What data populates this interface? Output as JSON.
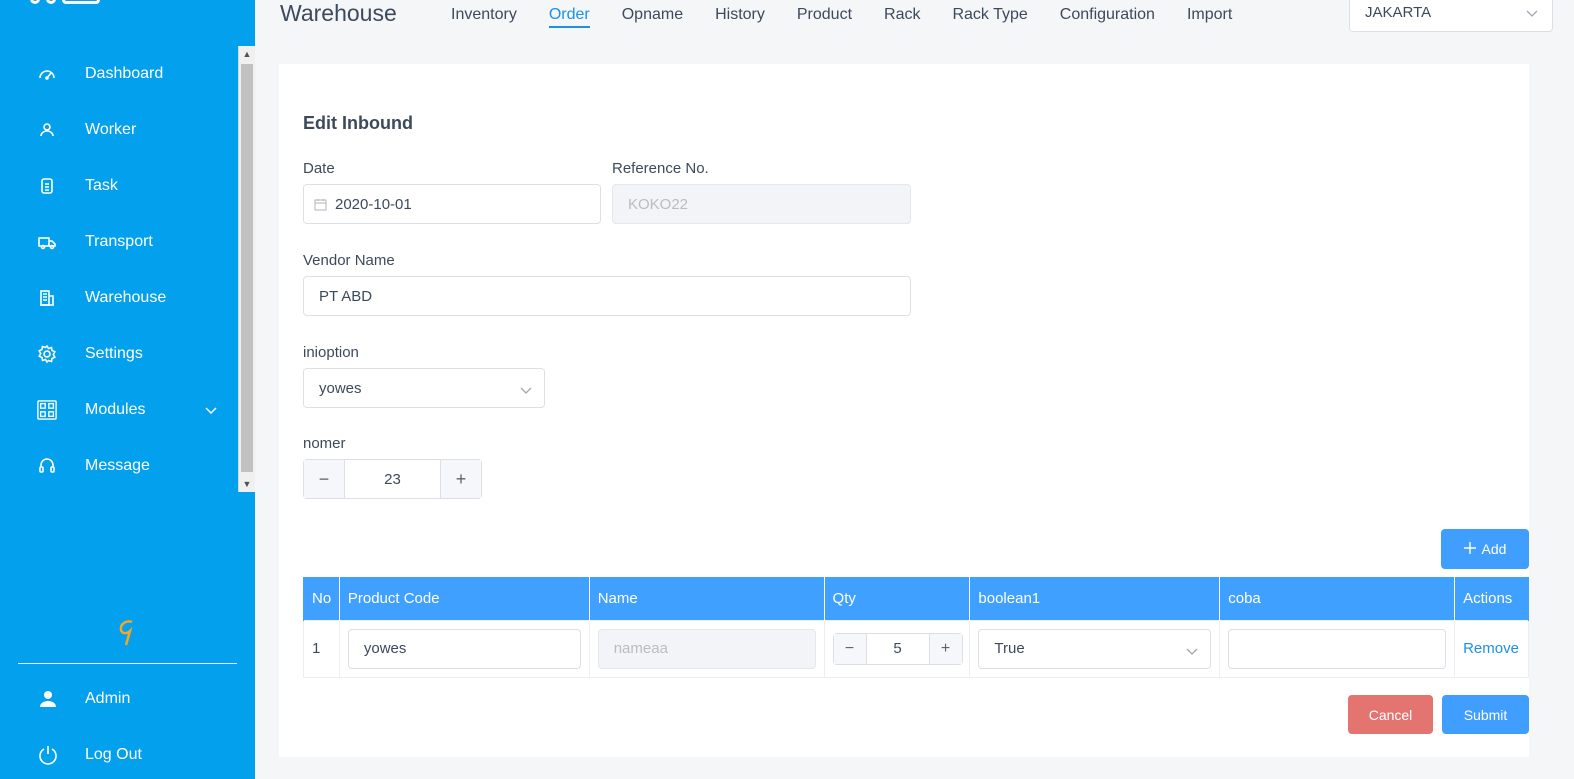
{
  "sidebar": {
    "nav_items": [
      {
        "label": "Dashboard",
        "icon": "gauge-icon"
      },
      {
        "label": "Worker",
        "icon": "user-outline-icon"
      },
      {
        "label": "Task",
        "icon": "clipboard-icon"
      },
      {
        "label": "Transport",
        "icon": "truck-icon"
      },
      {
        "label": "Warehouse",
        "icon": "building-icon"
      },
      {
        "label": "Settings",
        "icon": "gear-icon"
      },
      {
        "label": "Modules",
        "icon": "modules-icon"
      },
      {
        "label": "Message",
        "icon": "headset-icon"
      }
    ],
    "user_label": "Admin",
    "logout_label": "Log Out"
  },
  "header": {
    "title": "Warehouse",
    "tabs": [
      {
        "label": "Inventory"
      },
      {
        "label": "Order",
        "active": true
      },
      {
        "label": "Opname"
      },
      {
        "label": "History"
      },
      {
        "label": "Product"
      },
      {
        "label": "Rack"
      },
      {
        "label": "Rack Type"
      },
      {
        "label": "Configuration"
      },
      {
        "label": "Import"
      }
    ],
    "location": "JAKARTA"
  },
  "form": {
    "title": "Edit Inbound",
    "date_label": "Date",
    "date_value": "2020-10-01",
    "reference_label": "Reference No.",
    "reference_value": "KOKO22",
    "vendor_label": "Vendor Name",
    "vendor_value": "PT ABD",
    "inioption_label": "inioption",
    "inioption_value": "yowes",
    "nomer_label": "nomer",
    "nomer_value": "23",
    "add_label": "Add",
    "cancel_label": "Cancel",
    "submit_label": "Submit"
  },
  "table": {
    "columns": [
      "No",
      "Product Code",
      "Name",
      "Qty",
      "boolean1",
      "coba",
      "Actions"
    ],
    "rows": [
      {
        "no": "1",
        "product_code": "yowes",
        "name_placeholder": "nameaa",
        "qty": "5",
        "boolean1": "True",
        "coba": "",
        "action": "Remove"
      }
    ]
  },
  "colors": {
    "sidebar": "#03a0ee",
    "primary": "#409eff",
    "danger": "#e47470",
    "active_tab": "#1a90e6"
  }
}
